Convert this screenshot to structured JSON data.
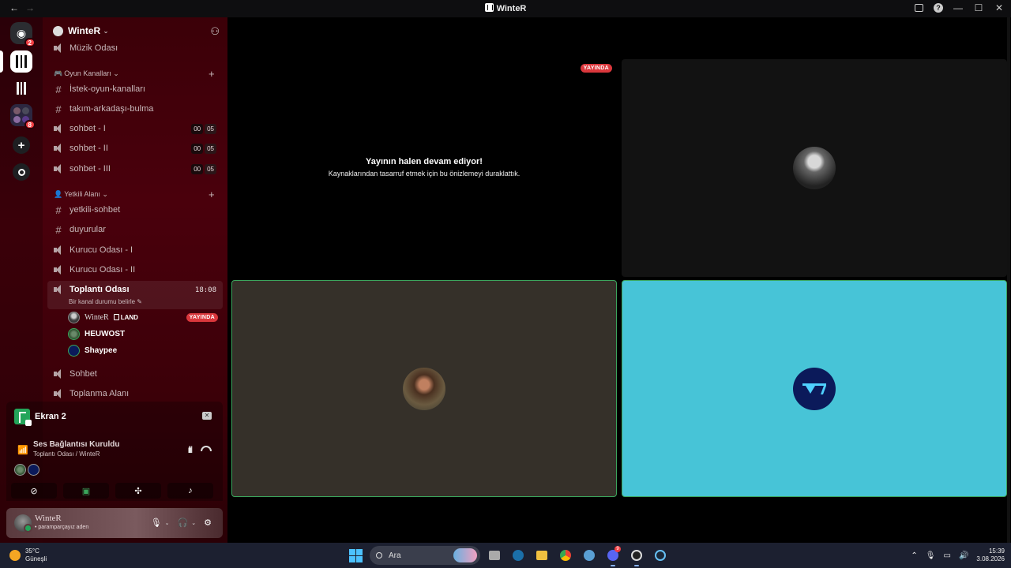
{
  "window": {
    "title": "WinteR",
    "back": "←",
    "forward": "→",
    "controls": {
      "minimize": "—",
      "maximize": "☐",
      "close": "✕",
      "help": "?"
    }
  },
  "rail": {
    "dm_badge": "2",
    "folder_badge": "8"
  },
  "server": {
    "name": "WinteR",
    "channels_top": [
      {
        "type": "voice",
        "name": "Müzik Odası"
      }
    ],
    "categories": [
      {
        "name": "Oyun Kanalları",
        "emoji": "🎮",
        "channels": [
          {
            "type": "text",
            "name": "İstek-oyun-kanalları"
          },
          {
            "type": "text",
            "name": "takım-arkadaşı-bulma"
          },
          {
            "type": "voice",
            "name": "sohbet - I",
            "count_a": "00",
            "count_b": "05"
          },
          {
            "type": "voice",
            "name": "sohbet - II",
            "count_a": "00",
            "count_b": "05"
          },
          {
            "type": "voice",
            "name": "sohbet - III",
            "count_a": "00",
            "count_b": "05"
          }
        ]
      },
      {
        "name": "Yetkili Alanı",
        "emoji": "👤",
        "channels": [
          {
            "type": "text",
            "name": "yetkili-sohbet"
          },
          {
            "type": "text",
            "name": "duyurular"
          },
          {
            "type": "voice",
            "name": "Kurucu Odası - I"
          },
          {
            "type": "voice",
            "name": "Kurucu Odası - II"
          },
          {
            "type": "voice",
            "name": "Toplantı Odası",
            "time": "18:08",
            "status": "Bir kanal durumu belirle",
            "active": true
          },
          {
            "type": "voice",
            "name": "Sohbet"
          },
          {
            "type": "voice",
            "name": "Toplanma Alanı"
          }
        ]
      }
    ],
    "voice_users": [
      {
        "name": "WinteR",
        "tag": "LAND",
        "live": "YAYINDA"
      },
      {
        "name": "HEUWOST"
      },
      {
        "name": "Shaypee"
      }
    ]
  },
  "screen_share": {
    "title": "Ekran 2"
  },
  "voice_connection": {
    "title": "Ses Bağlantısı Kuruldu",
    "subtitle": "Toplantı Odası / WinteR"
  },
  "user": {
    "name": "WinteR",
    "status": "• paramparçayız aden"
  },
  "stage": {
    "live_badge": "YAYINDA",
    "paused_title": "Yayının halen devam ediyor!",
    "paused_subtitle": "Kaynaklarından tasarruf etmek için bu önizlemeyi duraklattık."
  },
  "taskbar": {
    "weather_temp": "35°C",
    "weather_desc": "Güneşli",
    "search_placeholder": "Ara",
    "time": "15:39",
    "date": "3.08.2026",
    "discord_badge": "9"
  },
  "colors": {
    "live_red": "#da373c",
    "speaking_green": "#3ba55c",
    "cyan_tile": "#47c4d7"
  }
}
